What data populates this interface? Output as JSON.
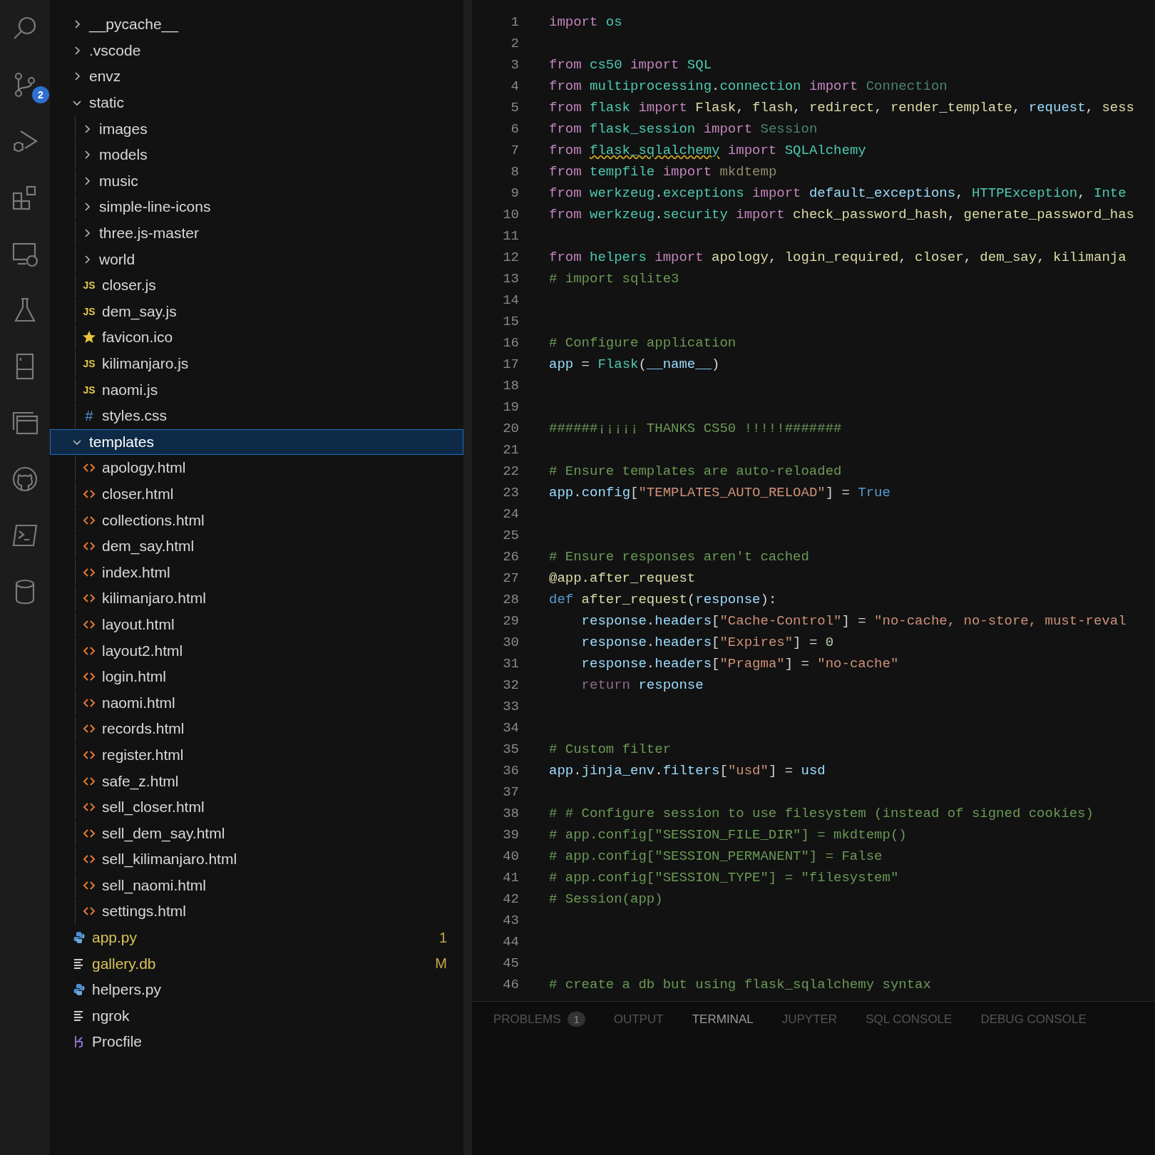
{
  "activity_bar": [
    {
      "kind": "search"
    },
    {
      "kind": "source-control",
      "badge": "2"
    },
    {
      "kind": "run-debug"
    },
    {
      "kind": "extensions"
    },
    {
      "kind": "remote"
    },
    {
      "kind": "testing"
    },
    {
      "kind": "notebook"
    },
    {
      "kind": "windows"
    },
    {
      "kind": "github"
    },
    {
      "kind": "terminal"
    },
    {
      "kind": "database"
    }
  ],
  "explorer": {
    "tree": [
      {
        "label": "__pycache__",
        "kind": "folder",
        "expanded": false,
        "selected": false,
        "modified": false
      },
      {
        "label": ".vscode",
        "kind": "folder",
        "expanded": false,
        "selected": false,
        "modified": false
      },
      {
        "label": "envz",
        "kind": "folder",
        "expanded": false,
        "selected": false,
        "modified": false
      },
      {
        "label": "static",
        "kind": "folder",
        "expanded": true,
        "selected": false,
        "modified": false,
        "children": [
          {
            "label": "images",
            "kind": "folder",
            "expanded": false,
            "selected": false,
            "modified": false
          },
          {
            "label": "models",
            "kind": "folder",
            "expanded": false,
            "selected": false,
            "modified": false
          },
          {
            "label": "music",
            "kind": "folder",
            "expanded": false,
            "selected": false,
            "modified": false
          },
          {
            "label": "simple-line-icons",
            "kind": "folder",
            "expanded": false,
            "selected": false,
            "modified": false
          },
          {
            "label": "three.js-master",
            "kind": "folder",
            "expanded": false,
            "selected": false,
            "modified": false
          },
          {
            "label": "world",
            "kind": "folder",
            "expanded": false,
            "selected": false,
            "modified": false
          },
          {
            "label": "closer.js",
            "kind": "glyph",
            "glyph": "JS",
            "selected": false,
            "modified": false
          },
          {
            "label": "dem_say.js",
            "kind": "glyph",
            "glyph": "JS",
            "selected": false,
            "modified": false
          },
          {
            "label": "favicon.ico",
            "kind": "star",
            "selected": false,
            "modified": false
          },
          {
            "label": "kilimanjaro.js",
            "kind": "glyph",
            "glyph": "JS",
            "selected": false,
            "modified": false
          },
          {
            "label": "naomi.js",
            "kind": "glyph",
            "glyph": "JS",
            "selected": false,
            "modified": false
          },
          {
            "label": "styles.css",
            "kind": "glyph",
            "glyph": "#",
            "selected": false,
            "modified": false
          }
        ]
      },
      {
        "label": "templates",
        "kind": "folder",
        "expanded": true,
        "selected": true,
        "modified": false,
        "children": [
          {
            "label": "apology.html",
            "kind": "html",
            "selected": false,
            "modified": false
          },
          {
            "label": "closer.html",
            "kind": "html",
            "selected": false,
            "modified": false
          },
          {
            "label": "collections.html",
            "kind": "html",
            "selected": false,
            "modified": false
          },
          {
            "label": "dem_say.html",
            "kind": "html",
            "selected": false,
            "modified": false
          },
          {
            "label": "index.html",
            "kind": "html",
            "selected": false,
            "modified": false
          },
          {
            "label": "kilimanjaro.html",
            "kind": "html",
            "selected": false,
            "modified": false
          },
          {
            "label": "layout.html",
            "kind": "html",
            "selected": false,
            "modified": false
          },
          {
            "label": "layout2.html",
            "kind": "html",
            "selected": false,
            "modified": false
          },
          {
            "label": "login.html",
            "kind": "html",
            "selected": false,
            "modified": false
          },
          {
            "label": "naomi.html",
            "kind": "html",
            "selected": false,
            "modified": false
          },
          {
            "label": "records.html",
            "kind": "html",
            "selected": false,
            "modified": false
          },
          {
            "label": "register.html",
            "kind": "html",
            "selected": false,
            "modified": false
          },
          {
            "label": "safe_z.html",
            "kind": "html",
            "selected": false,
            "modified": false
          },
          {
            "label": "sell_closer.html",
            "kind": "html",
            "selected": false,
            "modified": false
          },
          {
            "label": "sell_dem_say.html",
            "kind": "html",
            "selected": false,
            "modified": false
          },
          {
            "label": "sell_kilimanjaro.html",
            "kind": "html",
            "selected": false,
            "modified": false
          },
          {
            "label": "sell_naomi.html",
            "kind": "html",
            "selected": false,
            "modified": false
          },
          {
            "label": "settings.html",
            "kind": "html",
            "selected": false,
            "modified": false
          }
        ]
      },
      {
        "label": "app.py",
        "kind": "python",
        "selected": false,
        "modified": true,
        "decoration": "1"
      },
      {
        "label": "gallery.db",
        "kind": "text",
        "selected": false,
        "modified": true,
        "decoration": "M"
      },
      {
        "label": "helpers.py",
        "kind": "python",
        "selected": false,
        "modified": false
      },
      {
        "label": "ngrok",
        "kind": "text",
        "selected": false,
        "modified": false
      },
      {
        "label": "Procfile",
        "kind": "procfile",
        "selected": false,
        "modified": false
      }
    ]
  },
  "editor": {
    "lines": [
      {
        "number": "1",
        "segments": [
          {
            "kind": "kw",
            "text": "import"
          },
          {
            "kind": "mod",
            "text": " os"
          }
        ]
      },
      {
        "number": "2"
      },
      {
        "number": "3",
        "segments": [
          {
            "kind": "kw",
            "text": "from"
          },
          {
            "kind": "mod",
            "text": " cs50"
          },
          {
            "kind": "kw",
            "text": " import"
          },
          {
            "kind": "cls",
            "text": " SQL"
          }
        ]
      },
      {
        "number": "4",
        "segments": [
          {
            "kind": "kw",
            "text": "from"
          },
          {
            "kind": "mod",
            "text": " multiprocessing"
          },
          {
            "kind": "plain",
            "text": "."
          },
          {
            "kind": "mod",
            "text": "connection"
          },
          {
            "kind": "kw",
            "text": " import"
          },
          {
            "kind": "dimcls",
            "text": " Connection"
          }
        ]
      },
      {
        "number": "5",
        "segments": [
          {
            "kind": "kw",
            "text": "from"
          },
          {
            "kind": "mod",
            "text": " flask"
          },
          {
            "kind": "kw",
            "text": " import"
          },
          {
            "kind": "fn",
            "text": " Flask"
          },
          {
            "kind": "plain",
            "text": ","
          },
          {
            "kind": "fn",
            "text": " flash"
          },
          {
            "kind": "plain",
            "text": ","
          },
          {
            "kind": "fn",
            "text": " redirect"
          },
          {
            "kind": "plain",
            "text": ","
          },
          {
            "kind": "fn",
            "text": " render_template"
          },
          {
            "kind": "plain",
            "text": ","
          },
          {
            "kind": "var",
            "text": " request"
          },
          {
            "kind": "plain",
            "text": ","
          },
          {
            "kind": "fn",
            "text": " sess"
          }
        ]
      },
      {
        "number": "6",
        "segments": [
          {
            "kind": "kw",
            "text": "from"
          },
          {
            "kind": "mod",
            "text": " flask_session"
          },
          {
            "kind": "kw",
            "text": " import"
          },
          {
            "kind": "dimcls",
            "text": " Session"
          }
        ]
      },
      {
        "number": "7",
        "segments": [
          {
            "kind": "kw",
            "text": "from "
          },
          {
            "kind": "warnmod",
            "text": "flask_sqlalchemy"
          },
          {
            "kind": "kw",
            "text": " import"
          },
          {
            "kind": "cls",
            "text": " SQLAlchemy"
          }
        ]
      },
      {
        "number": "8",
        "segments": [
          {
            "kind": "kw",
            "text": "from"
          },
          {
            "kind": "mod",
            "text": " tempfile"
          },
          {
            "kind": "kw",
            "text": " import"
          },
          {
            "kind": "dimfn",
            "text": " mkdtemp"
          }
        ]
      },
      {
        "number": "9",
        "segments": [
          {
            "kind": "kw",
            "text": "from"
          },
          {
            "kind": "mod",
            "text": " werkzeug"
          },
          {
            "kind": "plain",
            "text": "."
          },
          {
            "kind": "mod",
            "text": "exceptions"
          },
          {
            "kind": "kw",
            "text": " import"
          },
          {
            "kind": "var",
            "text": " default_exceptions"
          },
          {
            "kind": "plain",
            "text": ","
          },
          {
            "kind": "cls",
            "text": " HTTPException"
          },
          {
            "kind": "plain",
            "text": ","
          },
          {
            "kind": "cls",
            "text": " Inte"
          }
        ]
      },
      {
        "number": "10",
        "segments": [
          {
            "kind": "kw",
            "text": "from"
          },
          {
            "kind": "mod",
            "text": " werkzeug"
          },
          {
            "kind": "plain",
            "text": "."
          },
          {
            "kind": "mod",
            "text": "security"
          },
          {
            "kind": "kw",
            "text": " import"
          },
          {
            "kind": "fn",
            "text": " check_password_hash"
          },
          {
            "kind": "plain",
            "text": ","
          },
          {
            "kind": "fn",
            "text": " generate_password_has"
          }
        ]
      },
      {
        "number": "11"
      },
      {
        "number": "12",
        "segments": [
          {
            "kind": "kw",
            "text": "from"
          },
          {
            "kind": "mod",
            "text": " helpers"
          },
          {
            "kind": "kw",
            "text": " import"
          },
          {
            "kind": "fn",
            "text": " apology"
          },
          {
            "kind": "plain",
            "text": ","
          },
          {
            "kind": "fn",
            "text": " login_required"
          },
          {
            "kind": "plain",
            "text": ","
          },
          {
            "kind": "fn",
            "text": " closer"
          },
          {
            "kind": "plain",
            "text": ","
          },
          {
            "kind": "fn",
            "text": " dem_say"
          },
          {
            "kind": "plain",
            "text": ","
          },
          {
            "kind": "fn",
            "text": " kilimanja"
          }
        ]
      },
      {
        "number": "13",
        "segments": [
          {
            "kind": "cm",
            "text": "# import sqlite3"
          }
        ]
      },
      {
        "number": "14"
      },
      {
        "number": "15"
      },
      {
        "number": "16",
        "segments": [
          {
            "kind": "cm",
            "text": "# Configure application"
          }
        ]
      },
      {
        "number": "17",
        "segments": [
          {
            "kind": "var",
            "text": "app"
          },
          {
            "kind": "plain",
            "text": " = "
          },
          {
            "kind": "cls",
            "text": "Flask"
          },
          {
            "kind": "plain",
            "text": "("
          },
          {
            "kind": "var",
            "text": "__name__"
          },
          {
            "kind": "plain",
            "text": ")"
          }
        ]
      },
      {
        "number": "18"
      },
      {
        "number": "19"
      },
      {
        "number": "20",
        "segments": [
          {
            "kind": "cm",
            "text": "######¡¡¡¡¡ THANKS CS50 !!!!!#######"
          }
        ]
      },
      {
        "number": "21"
      },
      {
        "number": "22",
        "segments": [
          {
            "kind": "cm",
            "text": "# Ensure templates are auto-reloaded"
          }
        ]
      },
      {
        "number": "23",
        "segments": [
          {
            "kind": "var",
            "text": "app"
          },
          {
            "kind": "plain",
            "text": "."
          },
          {
            "kind": "var",
            "text": "config"
          },
          {
            "kind": "plain",
            "text": "["
          },
          {
            "kind": "str",
            "text": "\"TEMPLATES_AUTO_RELOAD\""
          },
          {
            "kind": "plain",
            "text": "] = "
          },
          {
            "kind": "const",
            "text": "True"
          }
        ]
      },
      {
        "number": "24"
      },
      {
        "number": "25"
      },
      {
        "number": "26",
        "segments": [
          {
            "kind": "cm",
            "text": "# Ensure responses aren't cached"
          }
        ]
      },
      {
        "number": "27",
        "segments": [
          {
            "kind": "fn",
            "text": "@app.after_request"
          }
        ]
      },
      {
        "number": "28",
        "segments": [
          {
            "kind": "const",
            "text": "def"
          },
          {
            "kind": "fn",
            "text": " after_request"
          },
          {
            "kind": "plain",
            "text": "("
          },
          {
            "kind": "var",
            "text": "response"
          },
          {
            "kind": "plain",
            "text": "):"
          }
        ]
      },
      {
        "number": "29",
        "segments": [
          {
            "kind": "var",
            "text": "    response"
          },
          {
            "kind": "plain",
            "text": "."
          },
          {
            "kind": "var",
            "text": "headers"
          },
          {
            "kind": "plain",
            "text": "["
          },
          {
            "kind": "str",
            "text": "\"Cache-Control\""
          },
          {
            "kind": "plain",
            "text": "] = "
          },
          {
            "kind": "str",
            "text": "\"no-cache, no-store, must-reval"
          }
        ]
      },
      {
        "number": "30",
        "segments": [
          {
            "kind": "var",
            "text": "    response"
          },
          {
            "kind": "plain",
            "text": "."
          },
          {
            "kind": "var",
            "text": "headers"
          },
          {
            "kind": "plain",
            "text": "["
          },
          {
            "kind": "str",
            "text": "\"Expires\""
          },
          {
            "kind": "plain",
            "text": "] = "
          },
          {
            "kind": "num",
            "text": "0"
          }
        ]
      },
      {
        "number": "31",
        "segments": [
          {
            "kind": "var",
            "text": "    response"
          },
          {
            "kind": "plain",
            "text": "."
          },
          {
            "kind": "var",
            "text": "headers"
          },
          {
            "kind": "plain",
            "text": "["
          },
          {
            "kind": "str",
            "text": "\"Pragma\""
          },
          {
            "kind": "plain",
            "text": "] = "
          },
          {
            "kind": "str",
            "text": "\"no-cache\""
          }
        ]
      },
      {
        "number": "32",
        "segments": [
          {
            "kind": "dimkw",
            "text": "    return"
          },
          {
            "kind": "var",
            "text": " response"
          }
        ]
      },
      {
        "number": "33"
      },
      {
        "number": "34"
      },
      {
        "number": "35",
        "segments": [
          {
            "kind": "cm",
            "text": "# Custom filter"
          }
        ]
      },
      {
        "number": "36",
        "segments": [
          {
            "kind": "var",
            "text": "app"
          },
          {
            "kind": "plain",
            "text": "."
          },
          {
            "kind": "var",
            "text": "jinja_env"
          },
          {
            "kind": "plain",
            "text": "."
          },
          {
            "kind": "var",
            "text": "filters"
          },
          {
            "kind": "plain",
            "text": "["
          },
          {
            "kind": "str",
            "text": "\"usd\""
          },
          {
            "kind": "plain",
            "text": "] = "
          },
          {
            "kind": "var",
            "text": "usd"
          }
        ]
      },
      {
        "number": "37"
      },
      {
        "number": "38",
        "segments": [
          {
            "kind": "cm",
            "text": "# # Configure session to use filesystem (instead of signed cookies)"
          }
        ]
      },
      {
        "number": "39",
        "segments": [
          {
            "kind": "cm",
            "text": "# app.config[\"SESSION_FILE_DIR\"] = mkdtemp()"
          }
        ]
      },
      {
        "number": "40",
        "segments": [
          {
            "kind": "cm",
            "text": "# app.config[\"SESSION_PERMANENT\"] = False"
          }
        ]
      },
      {
        "number": "41",
        "segments": [
          {
            "kind": "cm",
            "text": "# app.config[\"SESSION_TYPE\"] = \"filesystem\""
          }
        ]
      },
      {
        "number": "42",
        "segments": [
          {
            "kind": "cm",
            "text": "# Session(app)"
          }
        ]
      },
      {
        "number": "43"
      },
      {
        "number": "44"
      },
      {
        "number": "45"
      },
      {
        "number": "46",
        "segments": [
          {
            "kind": "cm",
            "text": "# create a db but using flask_sqlalchemy syntax"
          }
        ]
      }
    ]
  },
  "panel": {
    "tabs": [
      {
        "label": "PROBLEMS",
        "badge": "1",
        "selected": false
      },
      {
        "label": "OUTPUT",
        "selected": false
      },
      {
        "label": "TERMINAL",
        "selected": true
      },
      {
        "label": "JUPYTER",
        "selected": false
      },
      {
        "label": "SQL CONSOLE",
        "selected": false
      },
      {
        "label": "DEBUG CONSOLE",
        "selected": false
      }
    ]
  }
}
